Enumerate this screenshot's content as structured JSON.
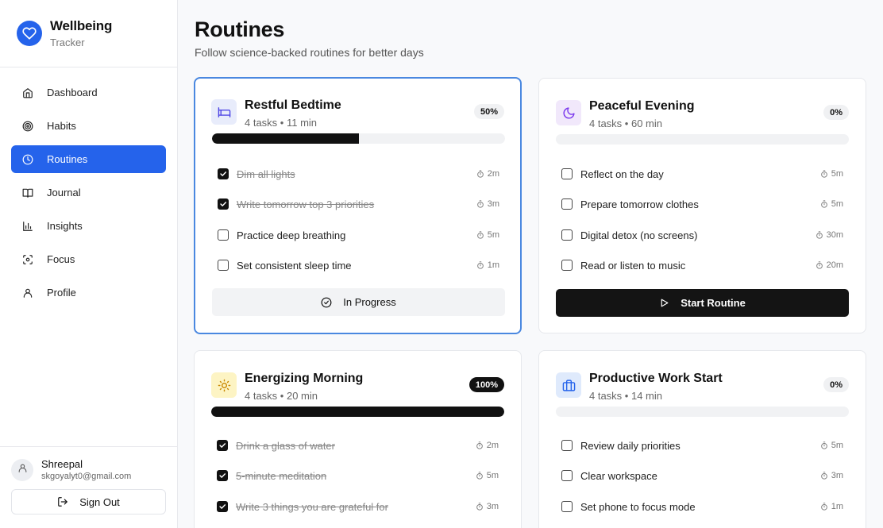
{
  "brand": {
    "title": "Wellbeing",
    "subtitle": "Tracker",
    "accent": "#2563eb"
  },
  "nav": [
    {
      "label": "Dashboard",
      "icon": "home-icon",
      "active": false
    },
    {
      "label": "Habits",
      "icon": "target-icon",
      "active": false
    },
    {
      "label": "Routines",
      "icon": "clock-icon",
      "active": true
    },
    {
      "label": "Journal",
      "icon": "book-icon",
      "active": false
    },
    {
      "label": "Insights",
      "icon": "bar-chart-icon",
      "active": false
    },
    {
      "label": "Focus",
      "icon": "focus-icon",
      "active": false
    },
    {
      "label": "Profile",
      "icon": "user-icon",
      "active": false
    }
  ],
  "user": {
    "name": "Shreepal",
    "email": "skgoyalyt0@gmail.com",
    "sign_out_label": "Sign Out"
  },
  "page": {
    "title": "Routines",
    "subtitle": "Follow science-backed routines for better days"
  },
  "routines": [
    {
      "title": "Restful Bedtime",
      "meta": "4 tasks • 11 min",
      "badge": "50%",
      "progress": 0.5,
      "icon": "bed-icon",
      "icon_bg": "#e8ecfb",
      "icon_color": "#4f46e5",
      "active": true,
      "tasks": [
        {
          "label": "Dim all lights",
          "time": "2m",
          "done": true
        },
        {
          "label": "Write tomorrow top 3 priorities",
          "time": "3m",
          "done": true
        },
        {
          "label": "Practice deep breathing",
          "time": "5m",
          "done": false
        },
        {
          "label": "Set consistent sleep time",
          "time": "1m",
          "done": false
        }
      ],
      "button": {
        "label": "In Progress",
        "style": "progress",
        "icon": "check-circle-icon"
      }
    },
    {
      "title": "Peaceful Evening",
      "meta": "4 tasks • 60 min",
      "badge": "0%",
      "progress": 0,
      "icon": "moon-icon",
      "icon_bg": "#f1e8fb",
      "icon_color": "#7c3aed",
      "active": false,
      "tasks": [
        {
          "label": "Reflect on the day",
          "time": "5m",
          "done": false
        },
        {
          "label": "Prepare tomorrow clothes",
          "time": "5m",
          "done": false
        },
        {
          "label": "Digital detox (no screens)",
          "time": "30m",
          "done": false
        },
        {
          "label": "Read or listen to music",
          "time": "20m",
          "done": false
        }
      ],
      "button": {
        "label": "Start Routine",
        "style": "start",
        "icon": "play-icon"
      }
    },
    {
      "title": "Energizing Morning",
      "meta": "4 tasks • 20 min",
      "badge": "100%",
      "progress": 1,
      "icon": "sun-icon",
      "icon_bg": "#fdf4c4",
      "icon_color": "#ca8a04",
      "active": false,
      "tasks": [
        {
          "label": "Drink a glass of water",
          "time": "2m",
          "done": true
        },
        {
          "label": "5-minute meditation",
          "time": "5m",
          "done": true
        },
        {
          "label": "Write 3 things you are grateful for",
          "time": "3m",
          "done": true
        }
      ]
    },
    {
      "title": "Productive Work Start",
      "meta": "4 tasks • 14 min",
      "badge": "0%",
      "progress": 0,
      "icon": "briefcase-icon",
      "icon_bg": "#dfeafc",
      "icon_color": "#2563eb",
      "active": false,
      "tasks": [
        {
          "label": "Review daily priorities",
          "time": "5m",
          "done": false
        },
        {
          "label": "Clear workspace",
          "time": "3m",
          "done": false
        },
        {
          "label": "Set phone to focus mode",
          "time": "1m",
          "done": false
        }
      ]
    }
  ]
}
